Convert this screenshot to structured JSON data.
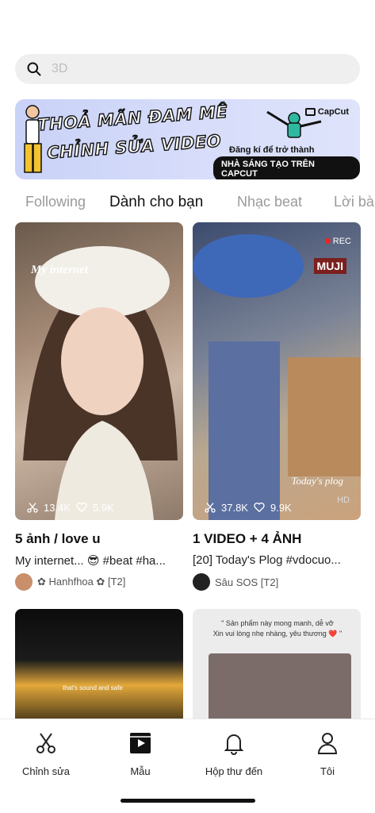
{
  "search": {
    "placeholder": "3D"
  },
  "banner": {
    "headline_line1": "THOẢ MÃN ĐAM MÊ",
    "headline_line2": "CHỈNH SỬA VIDEO",
    "cta_line1": "Đăng kí để trở thành",
    "cta_line2": "NHÀ SÁNG TẠO TRÊN CAPCUT",
    "brand": "CapCut"
  },
  "tabs": [
    {
      "label": "Following"
    },
    {
      "label": "Dành cho bạn"
    },
    {
      "label": "Nhạc beat"
    },
    {
      "label": "Lời bà"
    }
  ],
  "cards": [
    {
      "overlay_text": "My internet",
      "uses": "13.4K",
      "likes": "5.9K",
      "title": "5 ảnh / love u",
      "description": "My internet... 😎 #beat #ha...",
      "author": "✿ Hanhfhoa ✿ [T2]"
    },
    {
      "overlay_text": "Today's plog",
      "rec": "REC",
      "hd": "HD",
      "sign": "MUJI",
      "uses": "37.8K",
      "likes": "9.9K",
      "title": "1 VIDEO + 4 ẢNH",
      "description": "[20] Today's Plog #vdocuo...",
      "author": "Sâu SOS [T2]"
    },
    {
      "caption": "that's sound and safe"
    },
    {
      "quote_line1": "\" Sản phẩm này mong manh, dễ vỡ",
      "quote_line2": "Xin vui lòng nhẹ nhàng, yêu thương ❤️ \""
    }
  ],
  "nav": [
    {
      "label": "Chỉnh sửa",
      "icon": "scissors-icon"
    },
    {
      "label": "Mẫu",
      "icon": "clapperboard-icon"
    },
    {
      "label": "Hộp thư đến",
      "icon": "bell-icon"
    },
    {
      "label": "Tôi",
      "icon": "person-icon"
    }
  ]
}
